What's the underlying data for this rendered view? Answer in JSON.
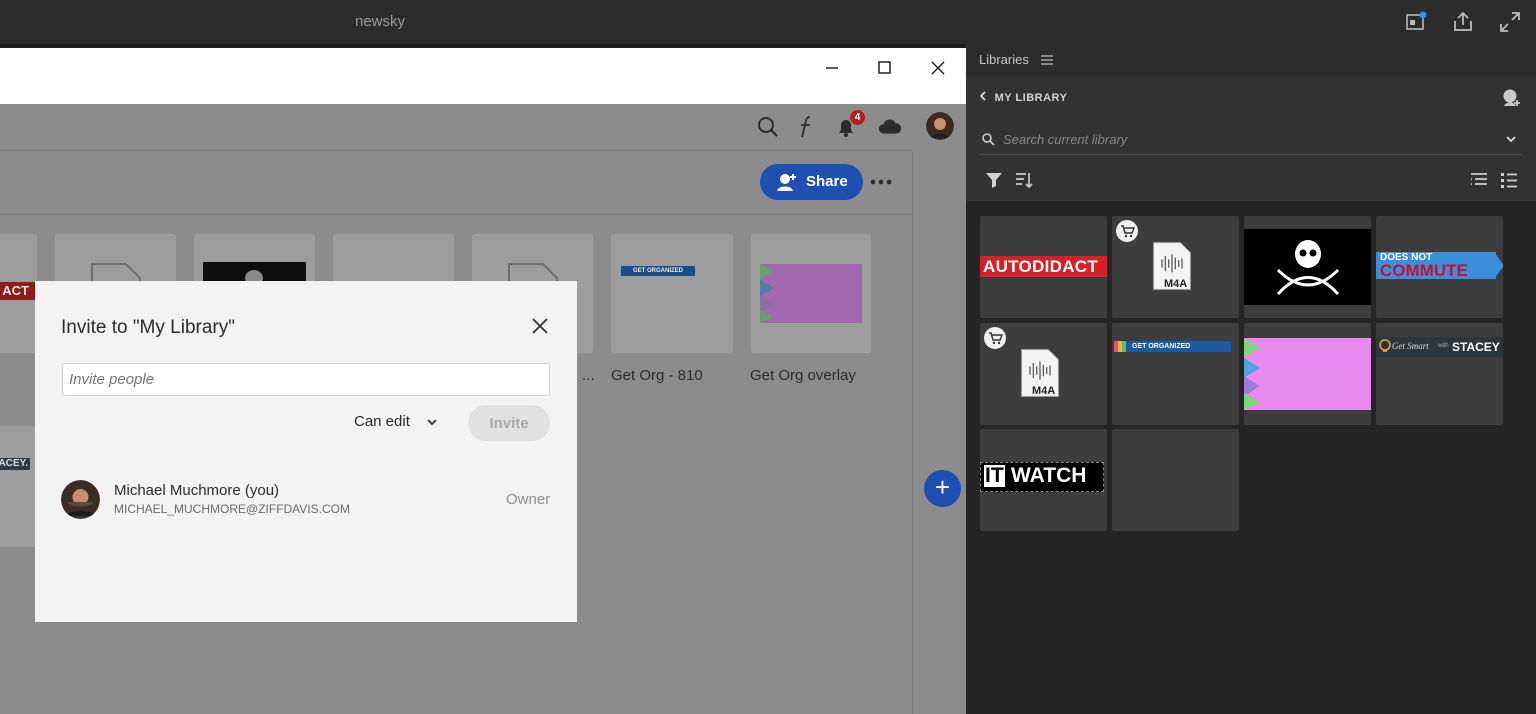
{
  "app": {
    "title": "newsky"
  },
  "web": {
    "share_label": "Share",
    "notification_count": "4",
    "tiles": [
      {
        "label": ""
      },
      {
        "label": ""
      },
      {
        "label": ""
      },
      {
        "label": ""
      },
      {
        "label": "..."
      },
      {
        "label": "Get Org - 810"
      },
      {
        "label": "Get Org overlay"
      }
    ],
    "tile_art": {
      "autodidact_fragment": "ACT",
      "get_organized": "GET ORGANIZED",
      "stacey_fragment": "ACEY."
    }
  },
  "dialog": {
    "title": "Invite to \"My Library\"",
    "invite_placeholder": "Invite people",
    "permission": "Can edit",
    "invite_label": "Invite",
    "member": {
      "name": "Michael Muchmore (you)",
      "email": "MICHAEL_MUCHMORE@ZIFFDAVIS.COM",
      "role": "Owner"
    }
  },
  "libraries": {
    "panel_title": "Libraries",
    "back_label": "MY LIBRARY",
    "search_placeholder": "Search current library",
    "assets": {
      "autodidact": "AUTODIDACT",
      "m4a_1": "M4A",
      "m4a_2": "M4A",
      "does_not": "DOES NOT",
      "commute": "COMMUTE",
      "get_organized": "GET ORGANIZED",
      "get_smart": "Get Smart",
      "with": "with",
      "stacey": "STACEY",
      "it": "IT",
      "watch": "WATCH"
    }
  },
  "colors": {
    "accent_blue": "#1f4fb0",
    "badge_red": "#b12020",
    "autodidact_red": "#d42027",
    "commute_red": "#c8102e",
    "commute_blue": "#3a8fd8",
    "pink": "#e98af0"
  }
}
